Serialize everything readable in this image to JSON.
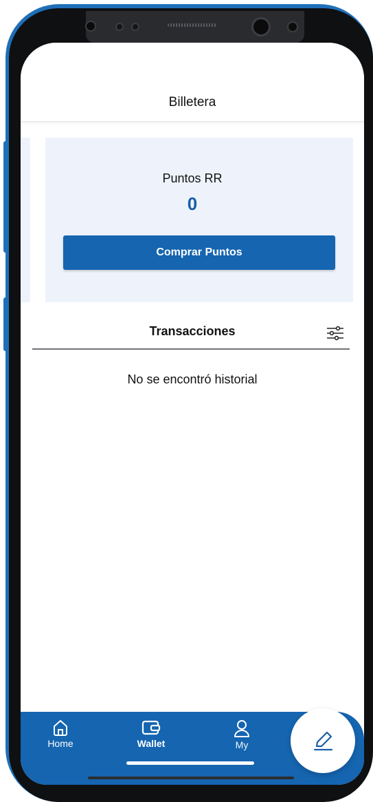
{
  "app": {
    "title": "Billetera"
  },
  "points_card": {
    "label": "Puntos RR",
    "value": "0",
    "buy_button_label": "Comprar Puntos"
  },
  "transactions": {
    "header": "Transacciones",
    "empty_message": "No se encontró historial",
    "filter_icon": "sliders-icon"
  },
  "bottom_nav": {
    "items": [
      {
        "label": "Home",
        "icon": "home-icon"
      },
      {
        "label": "Wallet",
        "icon": "wallet-icon",
        "active": true
      },
      {
        "label": "My",
        "icon": "user-icon"
      }
    ],
    "fab_icon": "pencil-icon"
  },
  "colors": {
    "accent": "#1565b0",
    "card_background": "#eef3fb",
    "points_value": "#1a5ea6",
    "phone_frame": "#1f6fb8"
  }
}
